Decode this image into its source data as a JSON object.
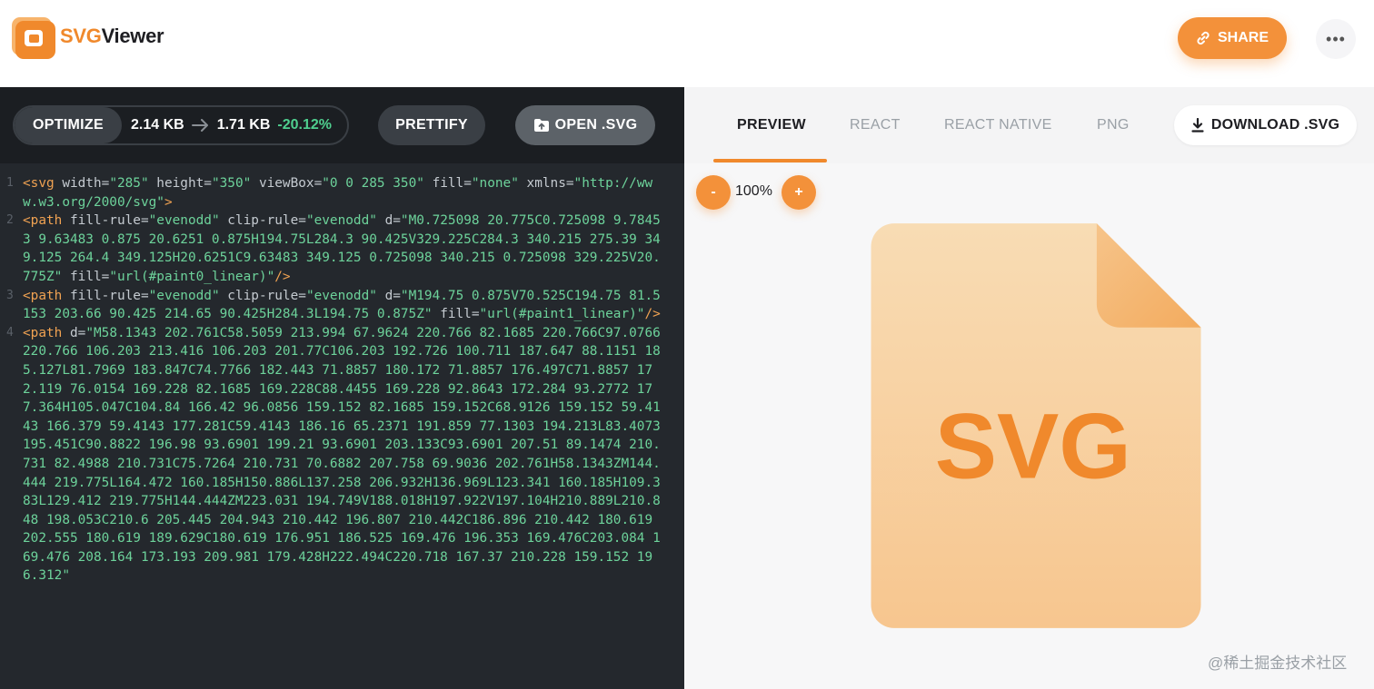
{
  "header": {
    "brand_svg": "SVG",
    "brand_viewer": "Viewer",
    "share_label": "SHARE",
    "more_label": "•••"
  },
  "toolbar": {
    "optimize_label": "OPTIMIZE",
    "original_size": "2.14 KB",
    "optimized_size": "1.71 KB",
    "reduction": "-20.12%",
    "prettify_label": "PRETTIFY",
    "open_label": "OPEN .SVG"
  },
  "code_lines": [
    {
      "num": "1",
      "tokens": [
        {
          "t": "tag",
          "v": "<svg"
        },
        {
          "t": "attr",
          "v": " width="
        },
        {
          "t": "val",
          "v": "\"285\""
        },
        {
          "t": "attr",
          "v": " height="
        },
        {
          "t": "val",
          "v": "\"350\""
        },
        {
          "t": "attr",
          "v": " viewBox="
        },
        {
          "t": "val",
          "v": "\"0 0 285 350\""
        },
        {
          "t": "attr",
          "v": " fill="
        },
        {
          "t": "val",
          "v": "\"none\""
        },
        {
          "t": "attr",
          "v": " xmlns="
        },
        {
          "t": "val",
          "v": "\"http://www.w3.org/2000/svg\""
        },
        {
          "t": "tag",
          "v": ">"
        }
      ]
    },
    {
      "num": "2",
      "tokens": [
        {
          "t": "tag",
          "v": "<path"
        },
        {
          "t": "attr",
          "v": " fill-rule="
        },
        {
          "t": "val",
          "v": "\"evenodd\""
        },
        {
          "t": "attr",
          "v": " clip-rule="
        },
        {
          "t": "val",
          "v": "\"evenodd\""
        },
        {
          "t": "attr",
          "v": " d="
        },
        {
          "t": "val",
          "v": "\"M0.725098 20.775C0.725098 9.78453 9.63483 0.875 20.6251 0.875H194.75L284.3 90.425V329.225C284.3 340.215 275.39 349.125 264.4 349.125H20.6251C9.63483 349.125 0.725098 340.215 0.725098 329.225V20.775Z\""
        },
        {
          "t": "attr",
          "v": " fill="
        },
        {
          "t": "val",
          "v": "\"url(#paint0_linear)\""
        },
        {
          "t": "tag",
          "v": "/>"
        }
      ]
    },
    {
      "num": "3",
      "tokens": [
        {
          "t": "tag",
          "v": "<path"
        },
        {
          "t": "attr",
          "v": " fill-rule="
        },
        {
          "t": "val",
          "v": "\"evenodd\""
        },
        {
          "t": "attr",
          "v": " clip-rule="
        },
        {
          "t": "val",
          "v": "\"evenodd\""
        },
        {
          "t": "attr",
          "v": " d="
        },
        {
          "t": "val",
          "v": "\"M194.75 0.875V70.525C194.75 81.5153 203.66 90.425 214.65 90.425H284.3L194.75 0.875Z\""
        },
        {
          "t": "attr",
          "v": " fill="
        },
        {
          "t": "val",
          "v": "\"url(#paint1_linear)\""
        },
        {
          "t": "tag",
          "v": "/>"
        }
      ]
    },
    {
      "num": "4",
      "tokens": [
        {
          "t": "tag",
          "v": "<path"
        },
        {
          "t": "attr",
          "v": " d="
        },
        {
          "t": "val",
          "v": "\"M58.1343 202.761C58.5059 213.994 67.9624 220.766 82.1685 220.766C97.0766 220.766 106.203 213.416 106.203 201.77C106.203 192.726 100.711 187.647 88.1151 185.127L81.7969 183.847C74.7766 182.443 71.8857 180.172 71.8857 176.497C71.8857 172.119 76.0154 169.228 82.1685 169.228C88.4455 169.228 92.8643 172.284 93.2772 177.364H105.047C104.84 166.42 96.0856 159.152 82.1685 159.152C68.9126 159.152 59.4143 166.379 59.4143 177.281C59.4143 186.16 65.2371 191.859 77.1303 194.213L83.4073 195.451C90.8822 196.98 93.6901 199.21 93.6901 203.133C93.6901 207.51 89.1474 210.731 82.4988 210.731C75.7264 210.731 70.6882 207.758 69.9036 202.761H58.1343ZM144.444 219.775L164.472 160.185H150.886L137.258 206.932H136.969L123.341 160.185H109.383L129.412 219.775H144.444ZM223.031 194.749V188.018H197.922V197.104H210.889L210.848 198.053C210.6 205.445 204.943 210.442 196.807 210.442C186.896 210.442 180.619 202.555 180.619 189.629C180.619 176.951 186.525 169.476 196.353 169.476C203.084 169.476 208.164 173.193 209.981 179.428H222.494C220.718 167.37 210.228 159.152 196.312\""
        }
      ]
    }
  ],
  "tabs": {
    "preview": "PREVIEW",
    "react": "REACT",
    "react_native": "REACT NATIVE",
    "png": "PNG",
    "download_label": "DOWNLOAD .SVG"
  },
  "zoom": {
    "minus": "-",
    "level": "100%",
    "plus": "+"
  },
  "preview": {
    "file_text": "SVG"
  },
  "watermark": "@稀土掘金技术社区",
  "colors": {
    "accent": "#f3913a",
    "code_bg": "#24282d",
    "code_tag": "#f0a252",
    "code_value": "#6dd39b"
  }
}
